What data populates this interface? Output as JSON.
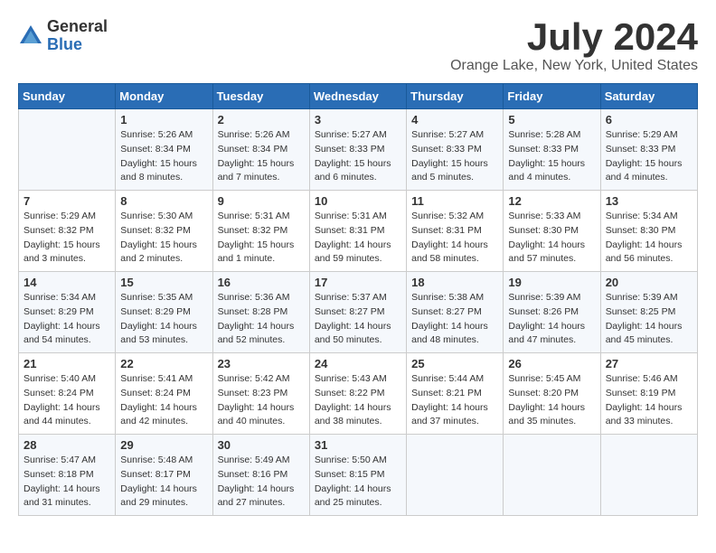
{
  "logo": {
    "general": "General",
    "blue": "Blue"
  },
  "title": "July 2024",
  "location": "Orange Lake, New York, United States",
  "days_of_week": [
    "Sunday",
    "Monday",
    "Tuesday",
    "Wednesday",
    "Thursday",
    "Friday",
    "Saturday"
  ],
  "weeks": [
    [
      {
        "day": "",
        "info": ""
      },
      {
        "day": "1",
        "info": "Sunrise: 5:26 AM\nSunset: 8:34 PM\nDaylight: 15 hours\nand 8 minutes."
      },
      {
        "day": "2",
        "info": "Sunrise: 5:26 AM\nSunset: 8:34 PM\nDaylight: 15 hours\nand 7 minutes."
      },
      {
        "day": "3",
        "info": "Sunrise: 5:27 AM\nSunset: 8:33 PM\nDaylight: 15 hours\nand 6 minutes."
      },
      {
        "day": "4",
        "info": "Sunrise: 5:27 AM\nSunset: 8:33 PM\nDaylight: 15 hours\nand 5 minutes."
      },
      {
        "day": "5",
        "info": "Sunrise: 5:28 AM\nSunset: 8:33 PM\nDaylight: 15 hours\nand 4 minutes."
      },
      {
        "day": "6",
        "info": "Sunrise: 5:29 AM\nSunset: 8:33 PM\nDaylight: 15 hours\nand 4 minutes."
      }
    ],
    [
      {
        "day": "7",
        "info": "Sunrise: 5:29 AM\nSunset: 8:32 PM\nDaylight: 15 hours\nand 3 minutes."
      },
      {
        "day": "8",
        "info": "Sunrise: 5:30 AM\nSunset: 8:32 PM\nDaylight: 15 hours\nand 2 minutes."
      },
      {
        "day": "9",
        "info": "Sunrise: 5:31 AM\nSunset: 8:32 PM\nDaylight: 15 hours\nand 1 minute."
      },
      {
        "day": "10",
        "info": "Sunrise: 5:31 AM\nSunset: 8:31 PM\nDaylight: 14 hours\nand 59 minutes."
      },
      {
        "day": "11",
        "info": "Sunrise: 5:32 AM\nSunset: 8:31 PM\nDaylight: 14 hours\nand 58 minutes."
      },
      {
        "day": "12",
        "info": "Sunrise: 5:33 AM\nSunset: 8:30 PM\nDaylight: 14 hours\nand 57 minutes."
      },
      {
        "day": "13",
        "info": "Sunrise: 5:34 AM\nSunset: 8:30 PM\nDaylight: 14 hours\nand 56 minutes."
      }
    ],
    [
      {
        "day": "14",
        "info": "Sunrise: 5:34 AM\nSunset: 8:29 PM\nDaylight: 14 hours\nand 54 minutes."
      },
      {
        "day": "15",
        "info": "Sunrise: 5:35 AM\nSunset: 8:29 PM\nDaylight: 14 hours\nand 53 minutes."
      },
      {
        "day": "16",
        "info": "Sunrise: 5:36 AM\nSunset: 8:28 PM\nDaylight: 14 hours\nand 52 minutes."
      },
      {
        "day": "17",
        "info": "Sunrise: 5:37 AM\nSunset: 8:27 PM\nDaylight: 14 hours\nand 50 minutes."
      },
      {
        "day": "18",
        "info": "Sunrise: 5:38 AM\nSunset: 8:27 PM\nDaylight: 14 hours\nand 48 minutes."
      },
      {
        "day": "19",
        "info": "Sunrise: 5:39 AM\nSunset: 8:26 PM\nDaylight: 14 hours\nand 47 minutes."
      },
      {
        "day": "20",
        "info": "Sunrise: 5:39 AM\nSunset: 8:25 PM\nDaylight: 14 hours\nand 45 minutes."
      }
    ],
    [
      {
        "day": "21",
        "info": "Sunrise: 5:40 AM\nSunset: 8:24 PM\nDaylight: 14 hours\nand 44 minutes."
      },
      {
        "day": "22",
        "info": "Sunrise: 5:41 AM\nSunset: 8:24 PM\nDaylight: 14 hours\nand 42 minutes."
      },
      {
        "day": "23",
        "info": "Sunrise: 5:42 AM\nSunset: 8:23 PM\nDaylight: 14 hours\nand 40 minutes."
      },
      {
        "day": "24",
        "info": "Sunrise: 5:43 AM\nSunset: 8:22 PM\nDaylight: 14 hours\nand 38 minutes."
      },
      {
        "day": "25",
        "info": "Sunrise: 5:44 AM\nSunset: 8:21 PM\nDaylight: 14 hours\nand 37 minutes."
      },
      {
        "day": "26",
        "info": "Sunrise: 5:45 AM\nSunset: 8:20 PM\nDaylight: 14 hours\nand 35 minutes."
      },
      {
        "day": "27",
        "info": "Sunrise: 5:46 AM\nSunset: 8:19 PM\nDaylight: 14 hours\nand 33 minutes."
      }
    ],
    [
      {
        "day": "28",
        "info": "Sunrise: 5:47 AM\nSunset: 8:18 PM\nDaylight: 14 hours\nand 31 minutes."
      },
      {
        "day": "29",
        "info": "Sunrise: 5:48 AM\nSunset: 8:17 PM\nDaylight: 14 hours\nand 29 minutes."
      },
      {
        "day": "30",
        "info": "Sunrise: 5:49 AM\nSunset: 8:16 PM\nDaylight: 14 hours\nand 27 minutes."
      },
      {
        "day": "31",
        "info": "Sunrise: 5:50 AM\nSunset: 8:15 PM\nDaylight: 14 hours\nand 25 minutes."
      },
      {
        "day": "",
        "info": ""
      },
      {
        "day": "",
        "info": ""
      },
      {
        "day": "",
        "info": ""
      }
    ]
  ]
}
